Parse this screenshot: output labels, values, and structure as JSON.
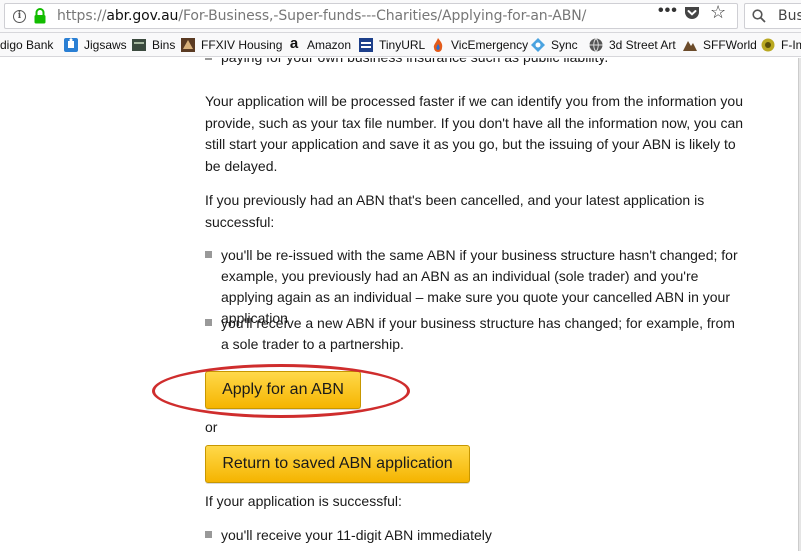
{
  "browser": {
    "url_prefix": "https://",
    "url_host": "abr.gov.au",
    "url_path": "/For-Business,-Super-funds---Charities/Applying-for-an-ABN/",
    "dots": "•••",
    "search_text": "Busi"
  },
  "bookmarks": [
    {
      "label": "digo Bank",
      "icon": "bank-icon"
    },
    {
      "label": "Jigsaws",
      "icon": "puzzle-icon"
    },
    {
      "label": "Bins",
      "icon": "bin-icon"
    },
    {
      "label": "FFXIV Housing",
      "icon": "ffxiv-icon"
    },
    {
      "label": "Amazon",
      "icon": "amazon-icon"
    },
    {
      "label": "TinyURL",
      "icon": "tinyurl-icon"
    },
    {
      "label": "VicEmergency",
      "icon": "fire-icon"
    },
    {
      "label": "Sync",
      "icon": "sync-icon"
    },
    {
      "label": "3d Street Art",
      "icon": "globe-icon"
    },
    {
      "label": "SFFWorld",
      "icon": "sffworld-icon"
    },
    {
      "label": "F-Im",
      "icon": "leaf-icon"
    }
  ],
  "content": {
    "top_bullet": "paying for your own business insurance such as public liability.",
    "para1": "Your application will be processed faster if we can identify you from the information you provide, such as your tax file number. If you don't have all the information now, you can still start your application and save it as you go, but the issuing of your ABN is likely to be delayed.",
    "para2": "If you previously had an ABN that's been cancelled, and your latest application is successful:",
    "bullet1": "you'll be re-issued with the same ABN if your business structure hasn't changed; for example, you previously had an ABN as an individual (sole trader) and you're applying again as an individual – make sure you quote your cancelled ABN in your application",
    "bullet2": "you'll receive a new ABN if your business structure has changed; for example, from a sole trader to a partnership.",
    "apply_button": "Apply for an ABN",
    "or_text": "or",
    "return_button": "Return to saved ABN application",
    "para3": "If your application is successful:",
    "bullet3": "you'll receive your 11-digit ABN immediately"
  },
  "colors": {
    "button_fill": "#f5b400",
    "annotation_ring": "#cf2d2d"
  }
}
